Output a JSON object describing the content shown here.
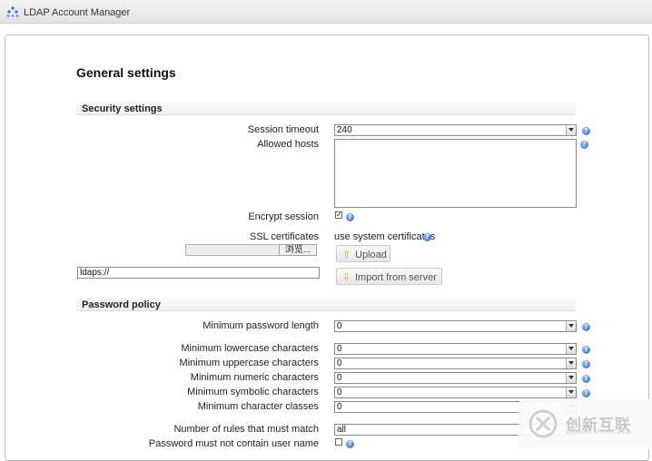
{
  "app": {
    "title": "LDAP Account Manager"
  },
  "page": {
    "heading": "General settings"
  },
  "security": {
    "section_title": "Security settings",
    "session_timeout": {
      "label": "Session timeout",
      "value": "240"
    },
    "allowed_hosts": {
      "label": "Allowed hosts",
      "value": ""
    },
    "encrypt_session": {
      "label": "Encrypt session",
      "checked": true
    },
    "ssl": {
      "label": "SSL certificates",
      "value": "use system certificates",
      "browse_label": "浏览...",
      "upload_label": "Upload",
      "import_label": "Import from server",
      "url_value": "ldaps://"
    }
  },
  "password_policy": {
    "section_title": "Password policy",
    "min_length": {
      "label": "Minimum password length",
      "value": "0"
    },
    "min_lower": {
      "label": "Minimum lowercase characters",
      "value": "0"
    },
    "min_upper": {
      "label": "Minimum uppercase characters",
      "value": "0"
    },
    "min_numeric": {
      "label": "Minimum numeric characters",
      "value": "0"
    },
    "min_symbolic": {
      "label": "Minimum symbolic characters",
      "value": "0"
    },
    "min_classes": {
      "label": "Minimum character classes",
      "value": "0"
    },
    "rules_match": {
      "label": "Number of rules that must match",
      "value": "all"
    },
    "no_username": {
      "label": "Password must not contain user name",
      "checked": false
    }
  },
  "watermark": {
    "cn": "创新互联",
    "en": "CHUANG XIN HU LIAN"
  },
  "colors": {
    "help_icon": "#2a68c4",
    "upload_icon": "#e0a020"
  }
}
